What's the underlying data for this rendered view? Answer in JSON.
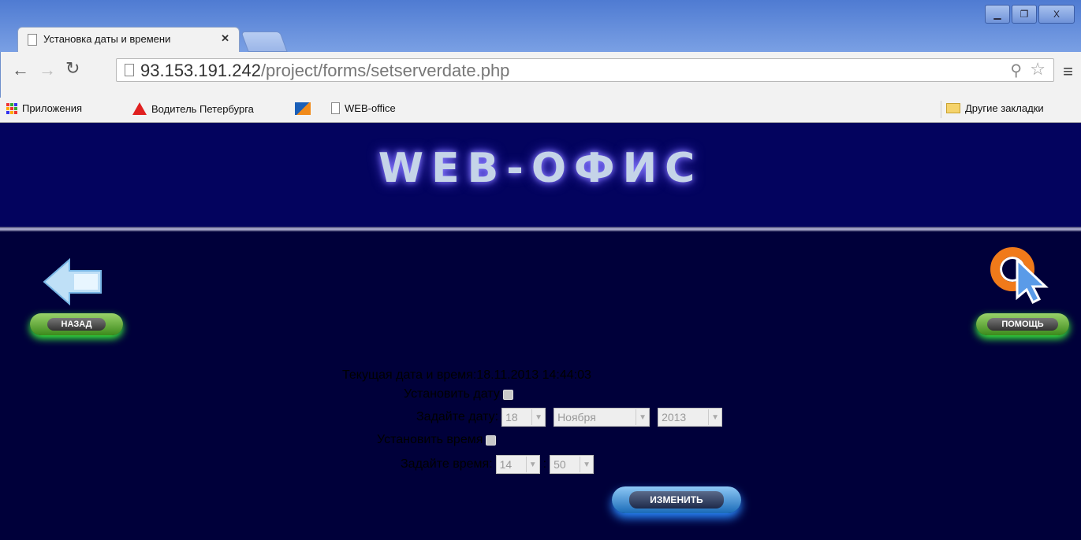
{
  "browser": {
    "tab_title": "Установка даты и времени",
    "tab_close": "✕",
    "url_host": "93.153.191.242",
    "url_path": "/project/forms/setserverdate.php",
    "window_controls": [
      "▁",
      "❐",
      "X"
    ]
  },
  "bookmarks": {
    "apps": "Приложения",
    "driver": "Водитель Петербурга",
    "weboffice": "WEB-office",
    "other": "Другие закладки"
  },
  "site": {
    "logo": "WEB-ОФИС",
    "back_label": "НАЗАД",
    "help_label": "ПОМОЩЬ"
  },
  "form": {
    "current_label": "Текущая дата и время:",
    "current_value": "18.11.2013 14:44:03",
    "set_date_label": "Установить дату",
    "enter_date_label": "Задайте дату:",
    "day": "18",
    "month": "Ноября",
    "year": "2013",
    "set_time_label": "Установить время",
    "enter_time_label": "Задайте время:",
    "hour": "14",
    "minute": "50",
    "time_sep": ":",
    "submit_label": "ИЗМЕНИТЬ"
  }
}
